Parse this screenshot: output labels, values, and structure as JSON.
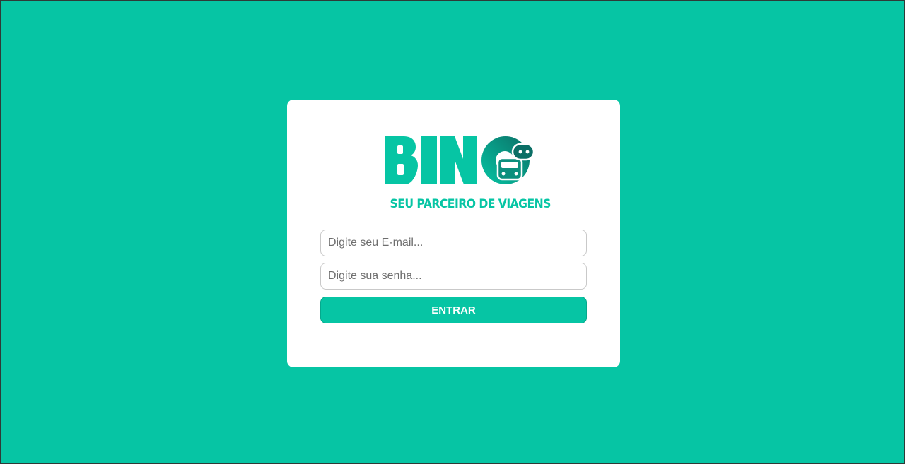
{
  "brand": {
    "logo_text": "BINO",
    "tagline": "SEU PARCEIRO DE VIAGENS"
  },
  "login": {
    "email_placeholder": "Digite seu E-mail...",
    "email_value": "",
    "password_placeholder": "Digite sua senha...",
    "password_value": "",
    "submit_label": "ENTRAR"
  },
  "colors": {
    "background": "#06c5a4",
    "card": "#ffffff",
    "accent": "#06c5a4",
    "logo_gradient_dark": "#0b6f66"
  }
}
